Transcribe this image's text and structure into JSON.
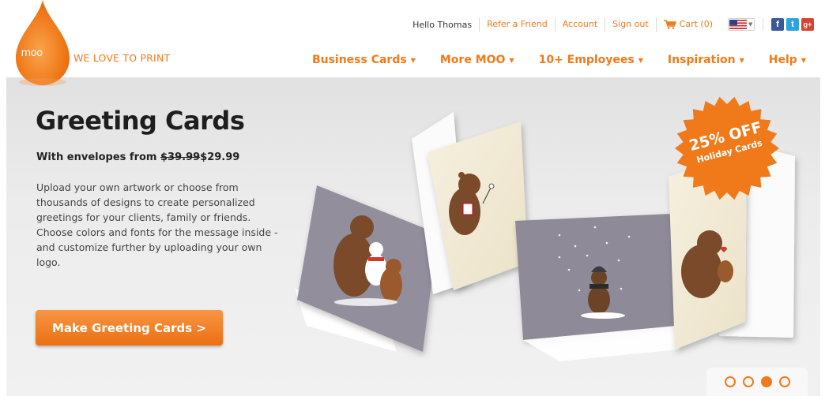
{
  "header": {
    "logo_text": "moo",
    "tagline": "WE LOVE TO PRINT",
    "greeting": "Hello Thomas",
    "top_links": [
      "Refer a Friend",
      "Account",
      "Sign out"
    ],
    "cart_label": "Cart (0)",
    "nav": [
      "Business Cards",
      "More MOO",
      "10+ Employees",
      "Inspiration",
      "Help"
    ],
    "social": [
      "f",
      "t",
      "g+"
    ]
  },
  "hero": {
    "title": "Greeting Cards",
    "subhead_prefix": "With envelopes from ",
    "old_price": "$39.99",
    "new_price": "$29.99",
    "description": "Upload your own artwork or choose from thousands of designs to create personalized greetings for your clients, family or friends. Choose colors and fonts for the message inside - and customize further by uploading your own logo.",
    "cta_label": "Make Greeting Cards >",
    "badge_line1": "25% OFF",
    "badge_line2": "Holiday Cards"
  },
  "carousel": {
    "slides": 4,
    "active_index": 2
  },
  "colors": {
    "brand_orange": "#f07a1a",
    "card_purple": "#8f8a97",
    "card_cream": "#f3ecd9"
  },
  "icons": [
    "moo-logo-drop",
    "cart-icon",
    "us-flag-icon",
    "facebook-icon",
    "twitter-icon",
    "google-plus-icon"
  ]
}
